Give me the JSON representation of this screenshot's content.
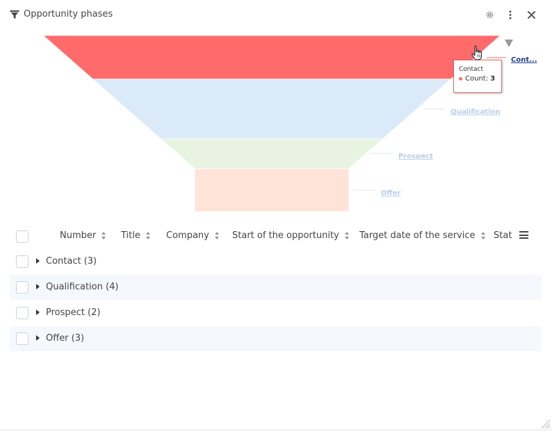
{
  "widget": {
    "title": "Opportunity phases",
    "icons": {
      "filter": "filter-icon",
      "settings": "gear-icon",
      "more": "kebab-menu-icon",
      "close": "close-icon"
    }
  },
  "chart_data": {
    "type": "funnel",
    "categories": [
      "Contact",
      "Qualification",
      "Prospect",
      "Offer"
    ],
    "display_labels": [
      "Cont...",
      "Qualification",
      "Prospect",
      "Offer"
    ],
    "values": [
      3,
      4,
      2,
      3
    ],
    "colors": [
      "#ff6b6b",
      "#dbeaf9",
      "#e8f4e1",
      "#ffe3d9"
    ],
    "label_colors": [
      "#1f3c88",
      "#b8cdea",
      "#b8cdea",
      "#b8cdea"
    ],
    "highlighted": "Contact"
  },
  "tooltip": {
    "category": "Contact",
    "series_label": "Count:",
    "value": "3"
  },
  "table": {
    "columns": [
      {
        "label": "Number",
        "sortable": true
      },
      {
        "label": "Title",
        "sortable": true
      },
      {
        "label": "Company",
        "sortable": true
      },
      {
        "label": "Start of the opportunity",
        "sortable": true
      },
      {
        "label": "Target date of the service",
        "sortable": true
      },
      {
        "label": "Stat",
        "sortable": false
      }
    ],
    "groups": [
      {
        "label": "Contact (3)"
      },
      {
        "label": "Qualification (4)"
      },
      {
        "label": "Prospect (2)"
      },
      {
        "label": "Offer (3)"
      }
    ]
  }
}
